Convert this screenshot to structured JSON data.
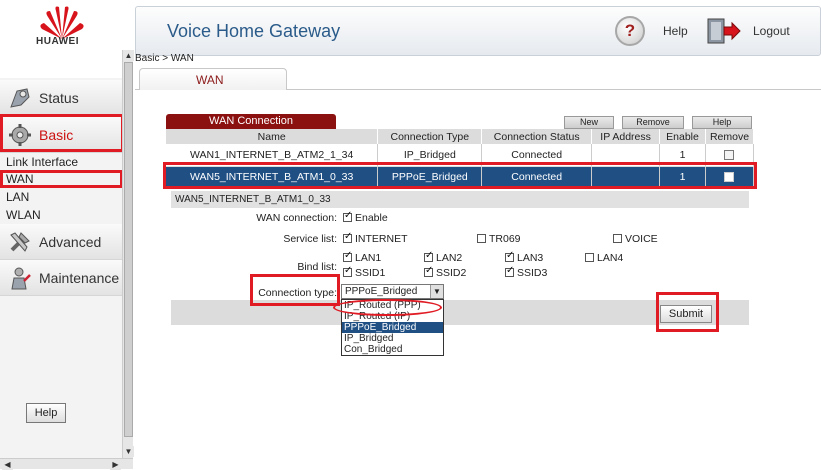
{
  "brand": {
    "name": "HUAWEI",
    "accent": "#cc1111",
    "highlight": "#e01b24"
  },
  "header": {
    "title": "Voice Home Gateway",
    "help_label": "Help",
    "logout_label": "Logout"
  },
  "sidebar": {
    "items": [
      {
        "label": "Status",
        "icon": "status-icon"
      },
      {
        "label": "Basic",
        "icon": "gear-icon",
        "active": true
      },
      {
        "label": "Advanced",
        "icon": "tools-icon"
      },
      {
        "label": "Maintenance",
        "icon": "maintenance-icon"
      }
    ],
    "sub_items": [
      "Link Interface",
      "WAN",
      "LAN",
      "WLAN"
    ],
    "help_label": "Help"
  },
  "breadcrumb": "Basic > WAN",
  "tab": {
    "label": "WAN"
  },
  "wan_panel": {
    "title": "WAN Connection",
    "buttons": {
      "new": "New",
      "remove": "Remove",
      "help": "Help"
    },
    "columns": [
      "Name",
      "Connection Type",
      "Connection Status",
      "IP Address",
      "Enable",
      "Remove"
    ],
    "rows": [
      {
        "name": "WAN1_INTERNET_B_ATM2_1_34",
        "type": "IP_Bridged",
        "status": "Connected",
        "ip": "",
        "enable": "1"
      },
      {
        "name": "WAN5_INTERNET_B_ATM1_0_33",
        "type": "PPPoE_Bridged",
        "status": "Connected",
        "ip": "",
        "enable": "1"
      }
    ]
  },
  "detail": {
    "title": "WAN5_INTERNET_B_ATM1_0_33",
    "wan_connection_label": "WAN connection:",
    "enable_label": "Enable",
    "service_list_label": "Service list:",
    "services": [
      "INTERNET",
      "TR069",
      "VOICE"
    ],
    "bind_list_label": "Bind list:",
    "bind": [
      "LAN1",
      "LAN2",
      "LAN3",
      "LAN4",
      "SSID1",
      "SSID2",
      "SSID3"
    ],
    "connection_type_label": "Connection type:",
    "connection_type_value": "PPPoE_Bridged",
    "connection_type_options": [
      "IP_Routed (PPP)",
      "IP_Routed (IP)",
      "PPPoE_Bridged",
      "IP_Bridged",
      "Con_Bridged"
    ],
    "submit_label": "Submit"
  }
}
